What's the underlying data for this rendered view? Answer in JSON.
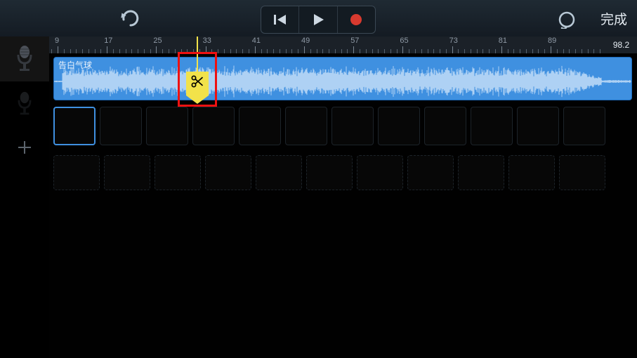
{
  "toolbar": {
    "done_label": "完成"
  },
  "ruler": {
    "labels": [
      9,
      17,
      25,
      33,
      41,
      49,
      57,
      65,
      73,
      81,
      89
    ],
    "tempo": "98.2"
  },
  "region": {
    "title": "告白气球"
  },
  "playhead": {
    "bar": 33
  },
  "icons": {
    "undo": "undo-icon",
    "prev": "skip-back-icon",
    "play": "play-icon",
    "record": "record-icon",
    "loop": "loop-icon",
    "mic": "microphone-icon",
    "add": "plus-icon",
    "scissors": "scissors-icon"
  }
}
